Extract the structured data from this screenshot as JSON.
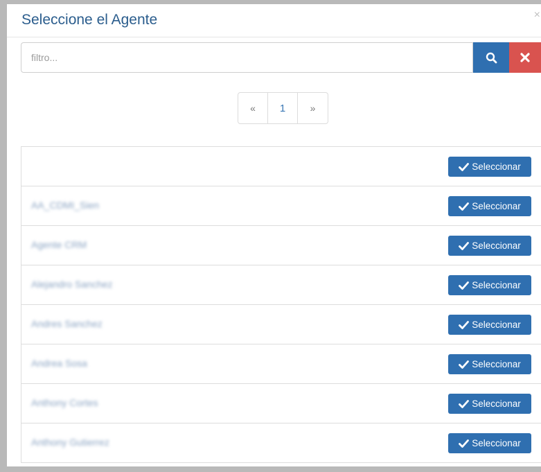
{
  "modal": {
    "title": "Seleccione el Agente",
    "close_symbol": "×"
  },
  "search": {
    "placeholder": "filtro...",
    "value": "",
    "search_icon": "search-icon",
    "clear_icon": "close-icon"
  },
  "pagination": {
    "prev": "«",
    "current": "1",
    "next": "»"
  },
  "rows": [
    {
      "name": "",
      "button": "Seleccionar"
    },
    {
      "name": "AA_CDMI_Sien",
      "button": "Seleccionar"
    },
    {
      "name": "Agente CRM",
      "button": "Seleccionar"
    },
    {
      "name": "Alejandro Sanchez",
      "button": "Seleccionar"
    },
    {
      "name": "Andres Sanchez",
      "button": "Seleccionar"
    },
    {
      "name": "Andrea Sosa",
      "button": "Seleccionar"
    },
    {
      "name": "Anthony Cortes",
      "button": "Seleccionar"
    },
    {
      "name": "Anthony Gutierrez",
      "button": "Seleccionar"
    }
  ],
  "colors": {
    "primary": "#2f6fb0",
    "danger": "#d9534f",
    "title": "#2b5d8d"
  }
}
